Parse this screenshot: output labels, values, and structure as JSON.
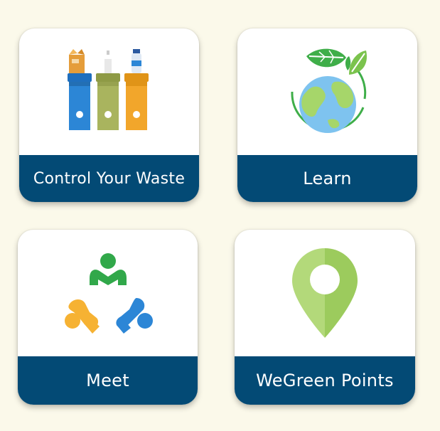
{
  "cards": [
    {
      "label": "Control Your Waste",
      "icon": "recycling-bins-icon"
    },
    {
      "label": "Learn",
      "icon": "earth-leaves-icon"
    },
    {
      "label": "Meet",
      "icon": "community-people-icon"
    },
    {
      "label": "WeGreen Points",
      "icon": "map-pin-icon"
    }
  ],
  "colors": {
    "background": "#fbf9ea",
    "label_bar": "#034a75",
    "bin_blue": "#2c86d6",
    "bin_green": "#a9b45e",
    "bin_orange": "#f2a62b",
    "earth_ocean": "#7ec3ef",
    "earth_land": "#a6d66a",
    "leaf_green": "#3fae49",
    "pin_green": "#a8d36a"
  }
}
